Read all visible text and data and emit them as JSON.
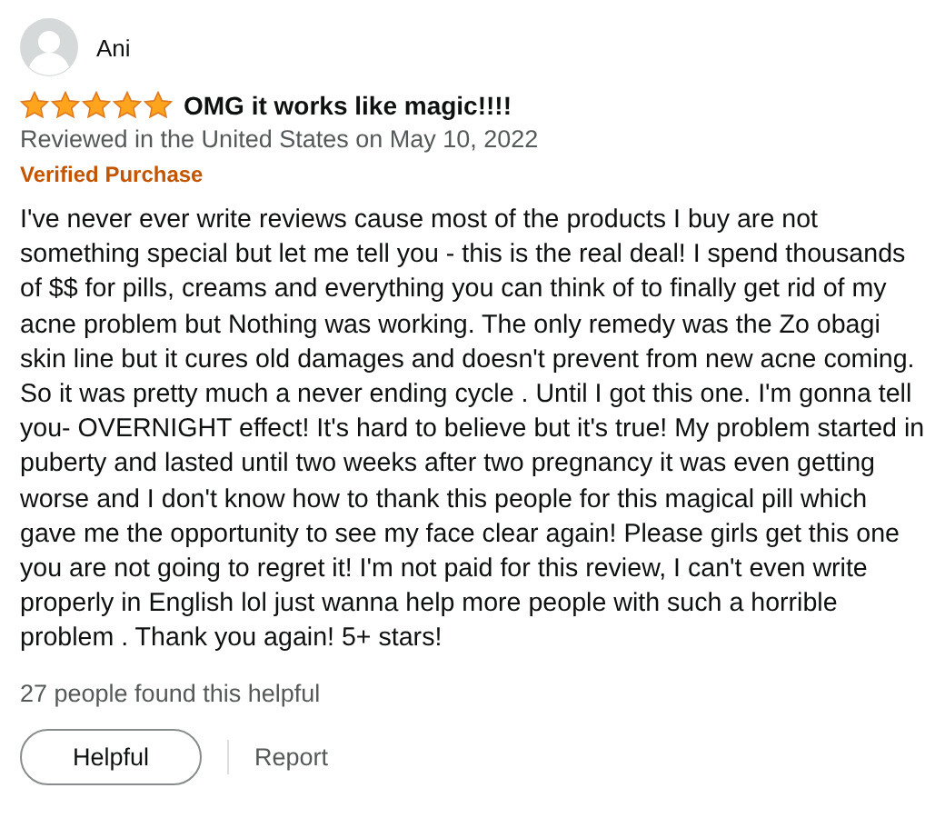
{
  "review": {
    "reviewer": "Ani",
    "stars": 5,
    "title": "OMG it works like magic!!!!",
    "meta": "Reviewed in the United States on May 10, 2022",
    "badge": "Verified Purchase",
    "body": "I've never ever write reviews cause most of the products I buy are not something special but let me tell you - this is the real deal! I spend thousands of $$ for pills, creams and everything you can think of to finally get rid of my acne problem but Nothing was working. The only remedy was the Zo obagi skin line but it cures old damages and doesn't prevent from new acne coming. So it was pretty much a never ending cycle . Until I got this one. I'm gonna tell you- OVERNIGHT effect! It's hard to believe but it's true! My problem started in puberty and lasted until two weeks after two pregnancy it was even getting worse and I don't know how to thank this people for this magical pill which gave me the opportunity to see my face clear again! Please girls get this one you are not going to regret it! I'm not paid for this review, I can't even write properly in English lol just wanna help more people with such a horrible problem . Thank you again! 5+ stars!",
    "helpful_count": "27 people found this helpful",
    "buttons": [
      {
        "kind": "primary",
        "label": "Helpful"
      },
      {
        "kind": "link",
        "label": "Report"
      }
    ]
  }
}
